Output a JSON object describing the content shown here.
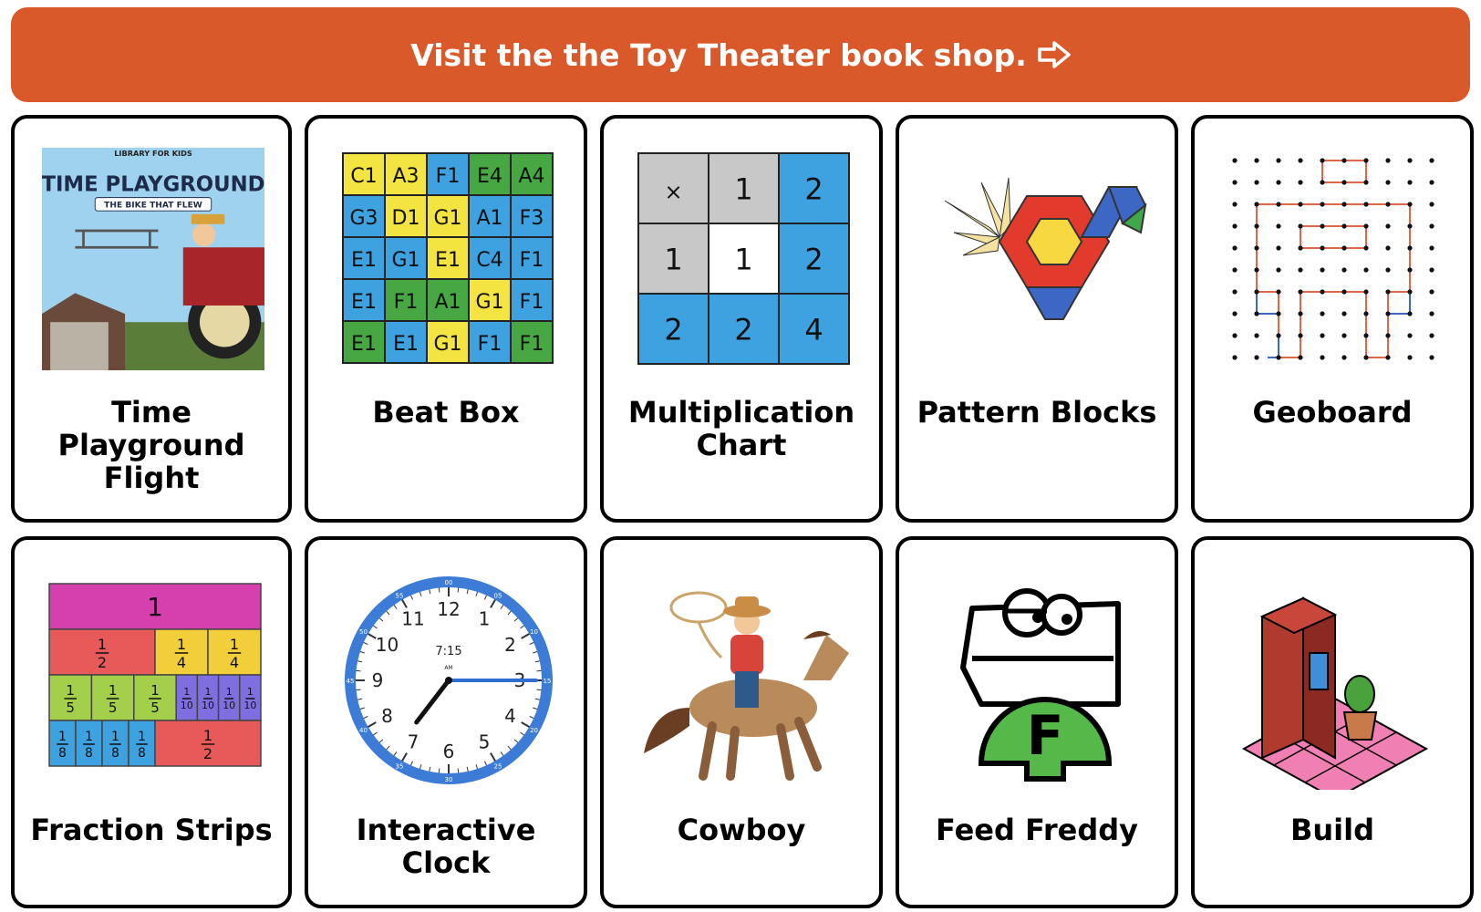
{
  "banner": {
    "text": "Visit the the Toy Theater book shop.",
    "icon": "arrow-right-icon",
    "color": "#d9592a"
  },
  "cards": [
    {
      "title": "Time Playground Flight",
      "cover_title": "TIME PLAYGROUND",
      "cover_subtitle": "THE BIKE THAT FLEW",
      "cover_logo": "LIBRARY FOR KIDS"
    },
    {
      "title": "Beat Box",
      "grid": [
        [
          "C1",
          "A3",
          "F1",
          "E4",
          "A4"
        ],
        [
          "G3",
          "D1",
          "G1",
          "A1",
          "F3"
        ],
        [
          "E1",
          "G1",
          "E1",
          "C4",
          "F1"
        ],
        [
          "E1",
          "F1",
          "A1",
          "G1",
          "F1"
        ],
        [
          "E1",
          "E1",
          "G1",
          "F1",
          "F1"
        ]
      ]
    },
    {
      "title": "Multiplication Chart",
      "grid": [
        [
          "×",
          "1",
          "2"
        ],
        [
          "1",
          "1",
          "2"
        ],
        [
          "2",
          "2",
          "4"
        ]
      ]
    },
    {
      "title": "Pattern Blocks"
    },
    {
      "title": "Geoboard"
    },
    {
      "title": "Fraction Strips",
      "strips": {
        "whole": "1",
        "half": [
          "1",
          "2"
        ],
        "quarter": [
          "1",
          "4"
        ],
        "fifth": [
          "1",
          "5"
        ],
        "tenth": [
          "1",
          "10"
        ],
        "eighth": [
          "1",
          "8"
        ]
      }
    },
    {
      "title": "Interactive Clock",
      "time": "7:15",
      "ampm": "AM",
      "numbers": [
        "12",
        "1",
        "2",
        "3",
        "4",
        "5",
        "6",
        "7",
        "8",
        "9",
        "10",
        "11"
      ],
      "minute_marks": [
        "00",
        "05",
        "10",
        "15",
        "20",
        "25",
        "30",
        "35",
        "40",
        "45",
        "50",
        "55"
      ]
    },
    {
      "title": "Cowboy"
    },
    {
      "title": "Feed Freddy",
      "letter": "F"
    },
    {
      "title": "Build"
    }
  ]
}
